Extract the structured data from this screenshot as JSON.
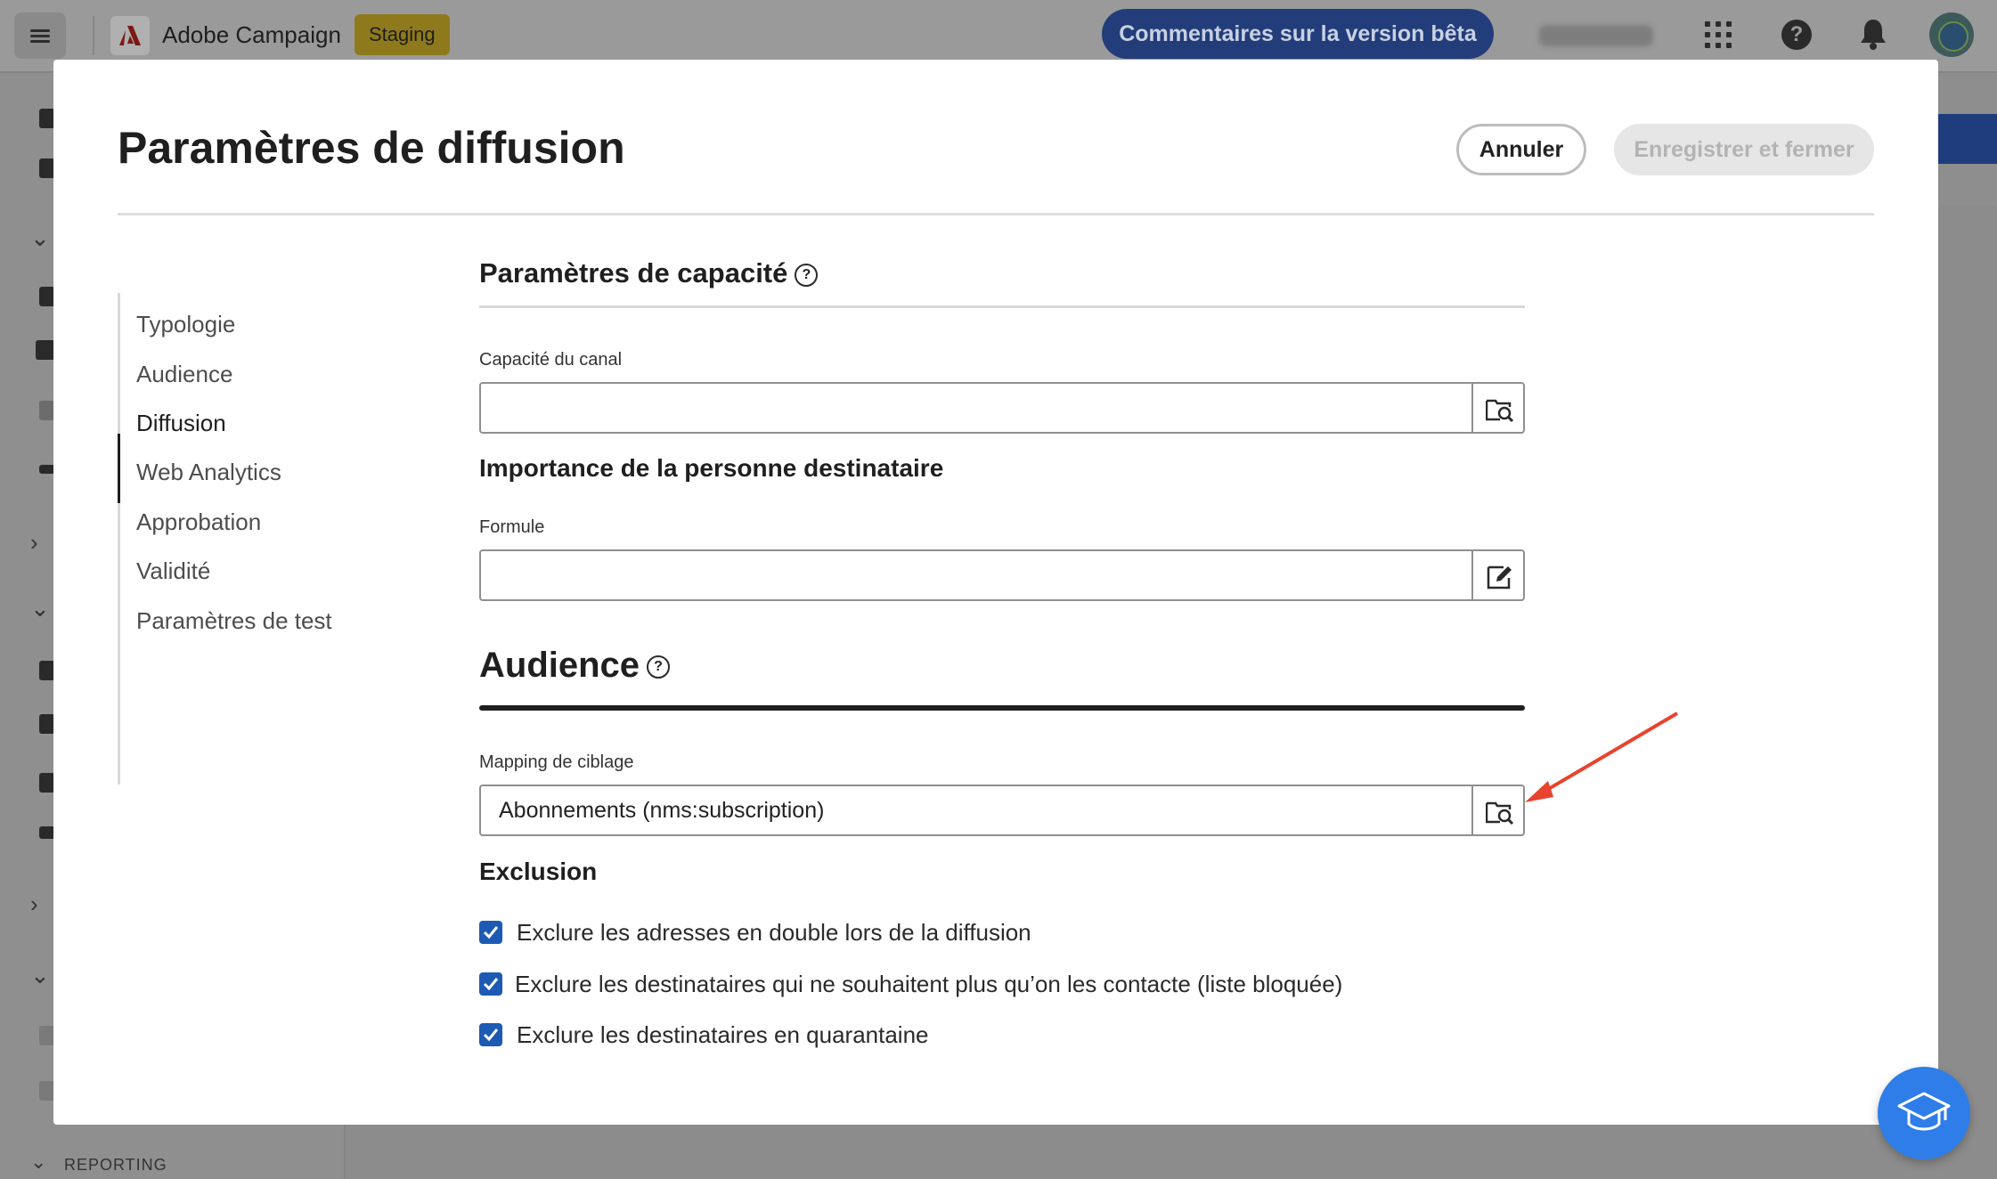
{
  "app": {
    "name": "Adobe Campaign",
    "environment_badge": "Staging",
    "beta_feedback_label": "Commentaires sur la version bêta",
    "org_name_blurred": "ACC NLB Ur"
  },
  "background": {
    "reporting_label": "REPORTING"
  },
  "modal": {
    "title": "Paramètres de diffusion",
    "cancel_label": "Annuler",
    "save_label": "Enregistrer et fermer",
    "nav": {
      "active": "Diffusion",
      "items": [
        {
          "label": "Typologie"
        },
        {
          "label": "Audience"
        },
        {
          "label": "Diffusion"
        },
        {
          "label": "Web Analytics"
        },
        {
          "label": "Approbation"
        },
        {
          "label": "Validité"
        },
        {
          "label": "Paramètres de test"
        }
      ]
    },
    "capacity": {
      "title": "Paramètres de capacité",
      "help_icon": "help-circle-icon",
      "channel_capacity_label": "Capacité du canal",
      "channel_capacity_value": "",
      "channel_capacity_button_icon": "folder-search-icon",
      "importance_title": "Importance de la personne destinataire",
      "formula_label": "Formule",
      "formula_value": "",
      "formula_button_icon": "edit-expression-icon"
    },
    "audience": {
      "title": "Audience",
      "help_icon": "help-circle-icon",
      "target_mapping_label": "Mapping de ciblage",
      "target_mapping_value": "Abonnements (nms:subscription)",
      "target_mapping_button_icon": "folder-search-icon",
      "exclusion_title": "Exclusion",
      "exclusions": [
        {
          "label": "Exclure les adresses en double lors de la diffusion",
          "checked": true
        },
        {
          "label": "Exclure les destinataires qui ne souhaitent plus qu’on les contacte (liste bloquée)",
          "checked": true
        },
        {
          "label": "Exclure les destinataires en quarantaine",
          "checked": true
        }
      ]
    }
  },
  "colors": {
    "accent_blue": "#1c5ab4",
    "annotation_arrow": "#e8432e",
    "learn_button": "#2e7de8"
  }
}
